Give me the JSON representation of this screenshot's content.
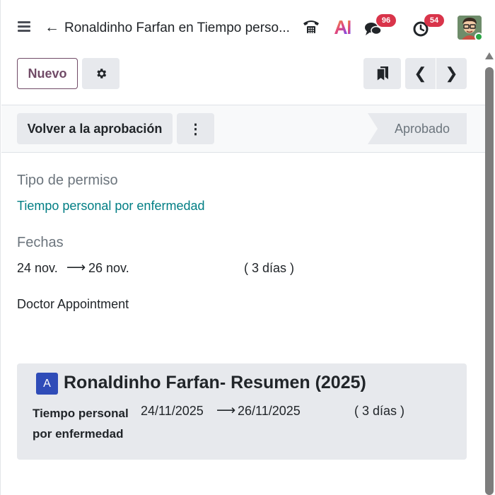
{
  "topbar": {
    "breadcrumb": "Ronaldinho Farfan en Tiempo perso...",
    "icons": [
      "menu-icon",
      "back-arrow-icon",
      "phone-icon",
      "ai-icon",
      "chat-icon",
      "activity-clock-icon",
      "user-avatar"
    ],
    "messages_count": "96",
    "activities_count": "54"
  },
  "control": {
    "new_label": "Nuevo"
  },
  "status": {
    "approval_button": "Volver a la aprobación",
    "more_label": "⋮",
    "stage": "Aprobado"
  },
  "form": {
    "leave_type_label": "Tipo de permiso",
    "leave_type_value": "Tiempo personal por enfermedad",
    "dates_label": "Fechas",
    "date_from": "24 nov.",
    "date_to": "26 nov.",
    "duration": "( 3 días )",
    "description": "Doctor Appointment"
  },
  "summary": {
    "badge": "A",
    "title": "Ronaldinho Farfan- Resumen (2025)",
    "type": "Tiempo personal por enfermedad",
    "date_from": "24/11/2025",
    "date_to": "26/11/2025",
    "duration": "( 3 días )"
  },
  "colors": {
    "primary": "#714b67",
    "link": "#017e84",
    "badge": "#d9344a",
    "card_badge": "#2f4cb8",
    "button_bg": "#e7e9ed"
  }
}
